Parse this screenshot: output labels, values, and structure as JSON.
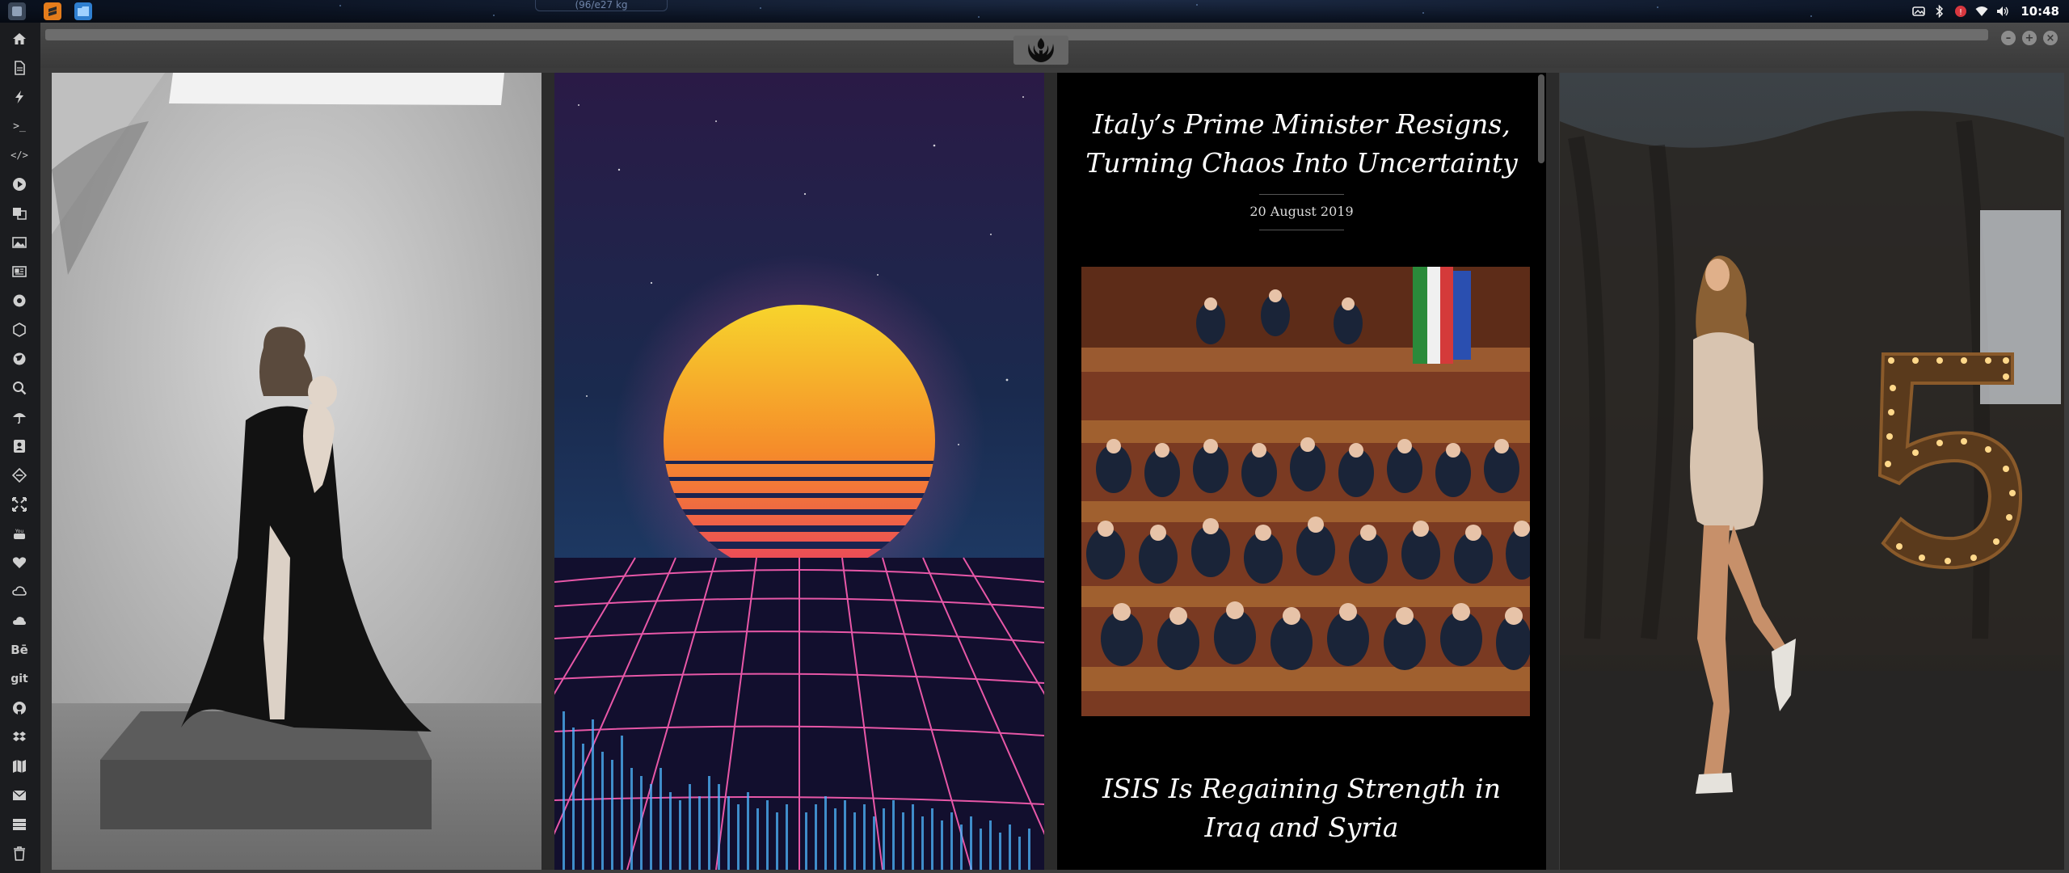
{
  "panel": {
    "widget_text": "(96/e27 kg",
    "clock": "10:48",
    "launchers": [
      "menu-icon",
      "sublime-text-icon",
      "files-icon"
    ],
    "tray_icons": [
      "screenshot-icon",
      "bluetooth-icon",
      "update-icon",
      "wifi-icon",
      "volume-icon"
    ]
  },
  "sidebar": {
    "items": [
      {
        "icon": "home-icon"
      },
      {
        "icon": "document-icon"
      },
      {
        "icon": "lightning-icon"
      },
      {
        "icon": "terminal-icon",
        "label": ">_"
      },
      {
        "icon": "code-icon",
        "label": "</>"
      },
      {
        "icon": "play-icon"
      },
      {
        "icon": "translate-icon"
      },
      {
        "icon": "image-icon"
      },
      {
        "icon": "newspaper-icon"
      },
      {
        "icon": "aperture-icon"
      },
      {
        "icon": "hexagon-icon"
      },
      {
        "icon": "globe-icon"
      },
      {
        "icon": "search-icon"
      },
      {
        "icon": "umbrella-icon"
      },
      {
        "icon": "contact-icon"
      },
      {
        "icon": "tag-icon"
      },
      {
        "icon": "expand-icon"
      },
      {
        "icon": "youtube-icon"
      },
      {
        "icon": "heart-icon"
      },
      {
        "icon": "creative-cloud-icon"
      },
      {
        "icon": "cloud-icon"
      },
      {
        "icon": "behance-icon",
        "label": "Bē"
      },
      {
        "icon": "git-icon",
        "label": "git"
      },
      {
        "icon": "github-icon"
      },
      {
        "icon": "dropbox-icon"
      },
      {
        "icon": "map-icon"
      },
      {
        "icon": "mail-icon"
      },
      {
        "icon": "server-icon"
      },
      {
        "icon": "trash-icon"
      }
    ]
  },
  "window": {
    "title_tab_icon": "rebel-alliance-icon",
    "controls": [
      "minimize-icon",
      "maximize-icon",
      "close-icon"
    ]
  },
  "news": {
    "headline_1": "Italy’s Prime Minister Resigns, Turning Chaos Into Uncertainty",
    "date": "20 August 2019",
    "headline_2": "ISIS Is Regaining Strength in Iraq and Syria"
  },
  "colors": {
    "sunset_top": "#f7d72c",
    "sunset_bottom": "#e8316a",
    "grid_pink": "#ff5fb5",
    "chanel_bulb": "#ffd88a"
  }
}
